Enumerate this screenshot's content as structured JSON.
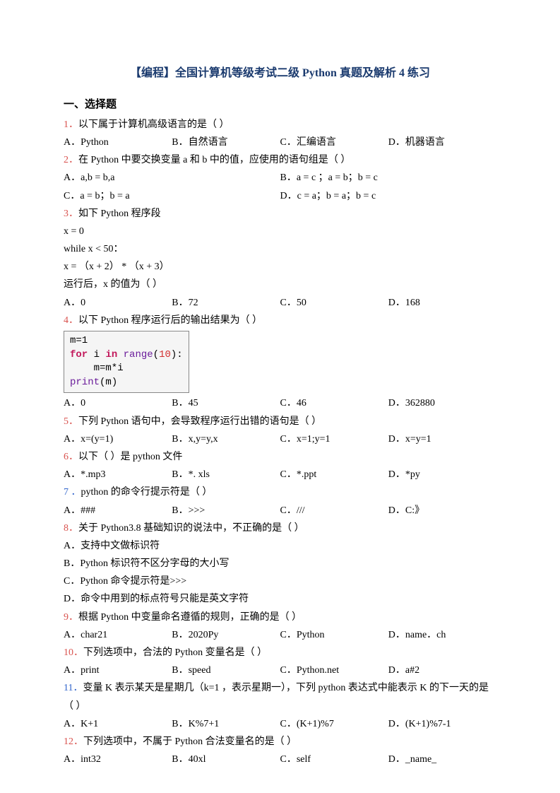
{
  "title": "【编程】全国计算机等级考试二级 Python 真题及解析 4 练习",
  "section_header": "一、选择题",
  "q1": {
    "num": "1．",
    "text": "以下属于计算机高级语言的是（    ）",
    "a": "A．Python",
    "b": "B．自然语言",
    "c": "C．汇编语言",
    "d": "D．机器语言"
  },
  "q2": {
    "num": "2．",
    "text": "在 Python 中要交换变量 a 和 b 中的值，应使用的语句组是（    ）",
    "a": "A．a,b = b,a",
    "b": "B．a = c ；a = b；b = c",
    "c": "C．a = b；b = a",
    "d": "D．c = a；b = a；b = c"
  },
  "q3": {
    "num": "3．",
    "text": "如下 Python 程序段",
    "code1": " x = 0",
    "code2": " while x < 50：",
    "code3": "    x = （x + 2） * （x + 3）",
    "text2": "运行后，x 的值为（ ）",
    "a": "A．0",
    "b": "B．72",
    "c": "C．50",
    "d": "D．168"
  },
  "q4": {
    "num": "4．",
    "text": "以下 Python 程序运行后的输出结果为（    ）",
    "code_m": "m=1",
    "code_for": "for",
    "code_i": " i ",
    "code_in": "in",
    "code_range": " range",
    "code_paren": "(",
    "code_10": "10",
    "code_close": "):",
    "code_body": "    m=m*i",
    "code_print": "print",
    "code_printarg": "(m)",
    "a": "A．0",
    "b": "B．45",
    "c": "C．46",
    "d": "D．362880"
  },
  "q5": {
    "num": "5．",
    "text": "下列 Python 语句中，会导致程序运行出错的语句是（     ）",
    "a": "A．x=(y=1)",
    "b": "B．x,y=y,x",
    "c": "C．x=1;y=1",
    "d": "D．x=y=1"
  },
  "q6": {
    "num": "6．",
    "text": "以下（           ）是 python 文件",
    "a": "A．*.mp3",
    "b": "B．*. xls",
    "c": "C．*.ppt",
    "d": "D．*py"
  },
  "q7": {
    "num": "7 ．",
    "text": "python 的命令行提示符是（    ）",
    "a": "A．###",
    "b": "B．>>>",
    "c": "C．///",
    "d": "D．C:》"
  },
  "q8": {
    "num": "8．",
    "text": "关于 Python3.8 基础知识的说法中，不正确的是（    ）",
    "a": "A．支持中文做标识符",
    "b": "B．Python 标识符不区分字母的大小写",
    "c": "C．Python 命令提示符是>>>",
    "d": "D．命令中用到的标点符号只能是英文字符"
  },
  "q9": {
    "num": "9．",
    "text": "根据 Python 中变量命名遵循的规则，正确的是（     ）",
    "a": "A．char21",
    "b": "B．2020Py",
    "c": "C．Python",
    "d": "D．name．ch"
  },
  "q10": {
    "num": "10．",
    "text": "下列选项中，合法的 Python 变量名是（    ）",
    "a": "A．print",
    "b": "B．speed",
    "c": "C．Python.net",
    "d": "D．a#2"
  },
  "q11": {
    "num": "11．",
    "text": "变量 K 表示某天是星期几（k=1 ，表示星期一），下列 python 表达式中能表示 K 的下一天的是（ ）",
    "a": "A．K+1",
    "b": "B．K%7+1",
    "c": "C．(K+1)%7",
    "d": "D．(K+1)%7-1"
  },
  "q12": {
    "num": "12．",
    "text": "下列选项中，不属于 Python 合法变量名的是（    ）",
    "a": "A．int32",
    "b": "B．40xl",
    "c": "C．self",
    "d": "D．_name_"
  }
}
